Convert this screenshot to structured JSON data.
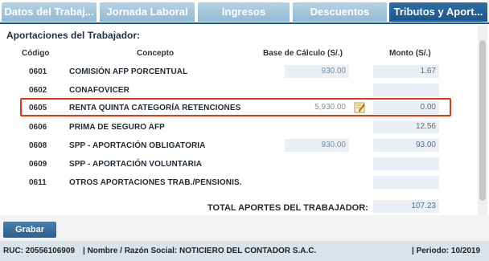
{
  "tabs": [
    {
      "label": "Datos del Trabaj..."
    },
    {
      "label": "Jornada Laboral"
    },
    {
      "label": "Ingresos"
    },
    {
      "label": "Descuentos"
    },
    {
      "label": "Tributos y Aport..."
    }
  ],
  "section": {
    "title": "Aportaciones del Trabajador:"
  },
  "columns": {
    "code": "Código",
    "concept": "Concepto",
    "base": "Base de Cálculo (S/.)",
    "monto": "Monto (S/.)"
  },
  "rows": [
    {
      "code": "0601",
      "concept": "COMISIÓN AFP PORCENTUAL",
      "base": "930.00",
      "monto": "1.67"
    },
    {
      "code": "0602",
      "concept": "CONAFOVICER",
      "base": "",
      "monto": ""
    },
    {
      "code": "0605",
      "concept": "RENTA QUINTA CATEGORÍA RETENCIONES",
      "base": "5,930.00",
      "monto": "0.00"
    },
    {
      "code": "0606",
      "concept": "PRIMA DE SEGURO AFP",
      "base": "",
      "monto": "12.56"
    },
    {
      "code": "0608",
      "concept": "SPP - APORTACIÓN OBLIGATORIA",
      "base": "930.00",
      "monto": "93.00"
    },
    {
      "code": "0609",
      "concept": "SPP - APORTACIÓN VOLUNTARIA",
      "base": "",
      "monto": ""
    },
    {
      "code": "0611",
      "concept": "OTROS APORTACIONES TRAB./PENSIONIS.",
      "base": "",
      "monto": ""
    }
  ],
  "total": {
    "label": "TOTAL APORTES DEL TRABAJADOR:",
    "value": "107.23"
  },
  "buttons": {
    "grabar": "Grabar"
  },
  "status": {
    "ruc": "RUC: 20556106909",
    "nombre": "| Nombre / Razón Social: NOTICIERO DEL CONTADOR S.A.C.",
    "periodo": "| Periodo: 10/2019"
  },
  "colors": {
    "accent": "#1c5690",
    "highlight": "#e03a17"
  }
}
